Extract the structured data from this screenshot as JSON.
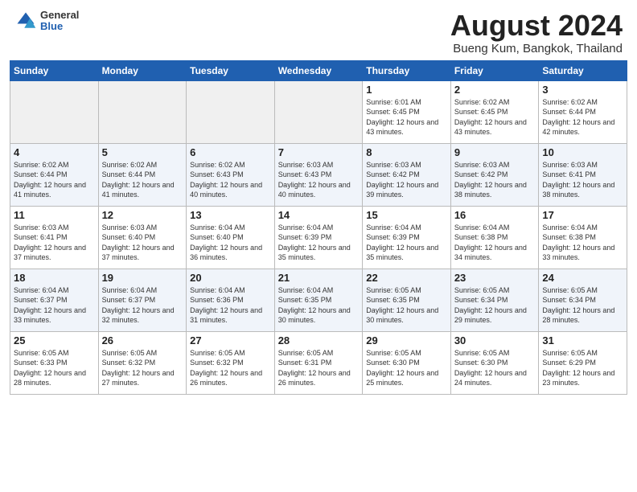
{
  "header": {
    "logo_general": "General",
    "logo_blue": "Blue",
    "title": "August 2024",
    "subtitle": "Bueng Kum, Bangkok, Thailand"
  },
  "weekdays": [
    "Sunday",
    "Monday",
    "Tuesday",
    "Wednesday",
    "Thursday",
    "Friday",
    "Saturday"
  ],
  "weeks": [
    [
      {
        "num": "",
        "empty": true
      },
      {
        "num": "",
        "empty": true
      },
      {
        "num": "",
        "empty": true
      },
      {
        "num": "",
        "empty": true
      },
      {
        "num": "1",
        "sunrise": "6:01 AM",
        "sunset": "6:45 PM",
        "daylight": "12 hours and 43 minutes."
      },
      {
        "num": "2",
        "sunrise": "6:02 AM",
        "sunset": "6:45 PM",
        "daylight": "12 hours and 43 minutes."
      },
      {
        "num": "3",
        "sunrise": "6:02 AM",
        "sunset": "6:44 PM",
        "daylight": "12 hours and 42 minutes."
      }
    ],
    [
      {
        "num": "4",
        "sunrise": "6:02 AM",
        "sunset": "6:44 PM",
        "daylight": "12 hours and 41 minutes."
      },
      {
        "num": "5",
        "sunrise": "6:02 AM",
        "sunset": "6:44 PM",
        "daylight": "12 hours and 41 minutes."
      },
      {
        "num": "6",
        "sunrise": "6:02 AM",
        "sunset": "6:43 PM",
        "daylight": "12 hours and 40 minutes."
      },
      {
        "num": "7",
        "sunrise": "6:03 AM",
        "sunset": "6:43 PM",
        "daylight": "12 hours and 40 minutes."
      },
      {
        "num": "8",
        "sunrise": "6:03 AM",
        "sunset": "6:42 PM",
        "daylight": "12 hours and 39 minutes."
      },
      {
        "num": "9",
        "sunrise": "6:03 AM",
        "sunset": "6:42 PM",
        "daylight": "12 hours and 38 minutes."
      },
      {
        "num": "10",
        "sunrise": "6:03 AM",
        "sunset": "6:41 PM",
        "daylight": "12 hours and 38 minutes."
      }
    ],
    [
      {
        "num": "11",
        "sunrise": "6:03 AM",
        "sunset": "6:41 PM",
        "daylight": "12 hours and 37 minutes."
      },
      {
        "num": "12",
        "sunrise": "6:03 AM",
        "sunset": "6:40 PM",
        "daylight": "12 hours and 37 minutes."
      },
      {
        "num": "13",
        "sunrise": "6:04 AM",
        "sunset": "6:40 PM",
        "daylight": "12 hours and 36 minutes."
      },
      {
        "num": "14",
        "sunrise": "6:04 AM",
        "sunset": "6:39 PM",
        "daylight": "12 hours and 35 minutes."
      },
      {
        "num": "15",
        "sunrise": "6:04 AM",
        "sunset": "6:39 PM",
        "daylight": "12 hours and 35 minutes."
      },
      {
        "num": "16",
        "sunrise": "6:04 AM",
        "sunset": "6:38 PM",
        "daylight": "12 hours and 34 minutes."
      },
      {
        "num": "17",
        "sunrise": "6:04 AM",
        "sunset": "6:38 PM",
        "daylight": "12 hours and 33 minutes."
      }
    ],
    [
      {
        "num": "18",
        "sunrise": "6:04 AM",
        "sunset": "6:37 PM",
        "daylight": "12 hours and 33 minutes."
      },
      {
        "num": "19",
        "sunrise": "6:04 AM",
        "sunset": "6:37 PM",
        "daylight": "12 hours and 32 minutes."
      },
      {
        "num": "20",
        "sunrise": "6:04 AM",
        "sunset": "6:36 PM",
        "daylight": "12 hours and 31 minutes."
      },
      {
        "num": "21",
        "sunrise": "6:04 AM",
        "sunset": "6:35 PM",
        "daylight": "12 hours and 30 minutes."
      },
      {
        "num": "22",
        "sunrise": "6:05 AM",
        "sunset": "6:35 PM",
        "daylight": "12 hours and 30 minutes."
      },
      {
        "num": "23",
        "sunrise": "6:05 AM",
        "sunset": "6:34 PM",
        "daylight": "12 hours and 29 minutes."
      },
      {
        "num": "24",
        "sunrise": "6:05 AM",
        "sunset": "6:34 PM",
        "daylight": "12 hours and 28 minutes."
      }
    ],
    [
      {
        "num": "25",
        "sunrise": "6:05 AM",
        "sunset": "6:33 PM",
        "daylight": "12 hours and 28 minutes."
      },
      {
        "num": "26",
        "sunrise": "6:05 AM",
        "sunset": "6:32 PM",
        "daylight": "12 hours and 27 minutes."
      },
      {
        "num": "27",
        "sunrise": "6:05 AM",
        "sunset": "6:32 PM",
        "daylight": "12 hours and 26 minutes."
      },
      {
        "num": "28",
        "sunrise": "6:05 AM",
        "sunset": "6:31 PM",
        "daylight": "12 hours and 26 minutes."
      },
      {
        "num": "29",
        "sunrise": "6:05 AM",
        "sunset": "6:30 PM",
        "daylight": "12 hours and 25 minutes."
      },
      {
        "num": "30",
        "sunrise": "6:05 AM",
        "sunset": "6:30 PM",
        "daylight": "12 hours and 24 minutes."
      },
      {
        "num": "31",
        "sunrise": "6:05 AM",
        "sunset": "6:29 PM",
        "daylight": "12 hours and 23 minutes."
      }
    ]
  ]
}
